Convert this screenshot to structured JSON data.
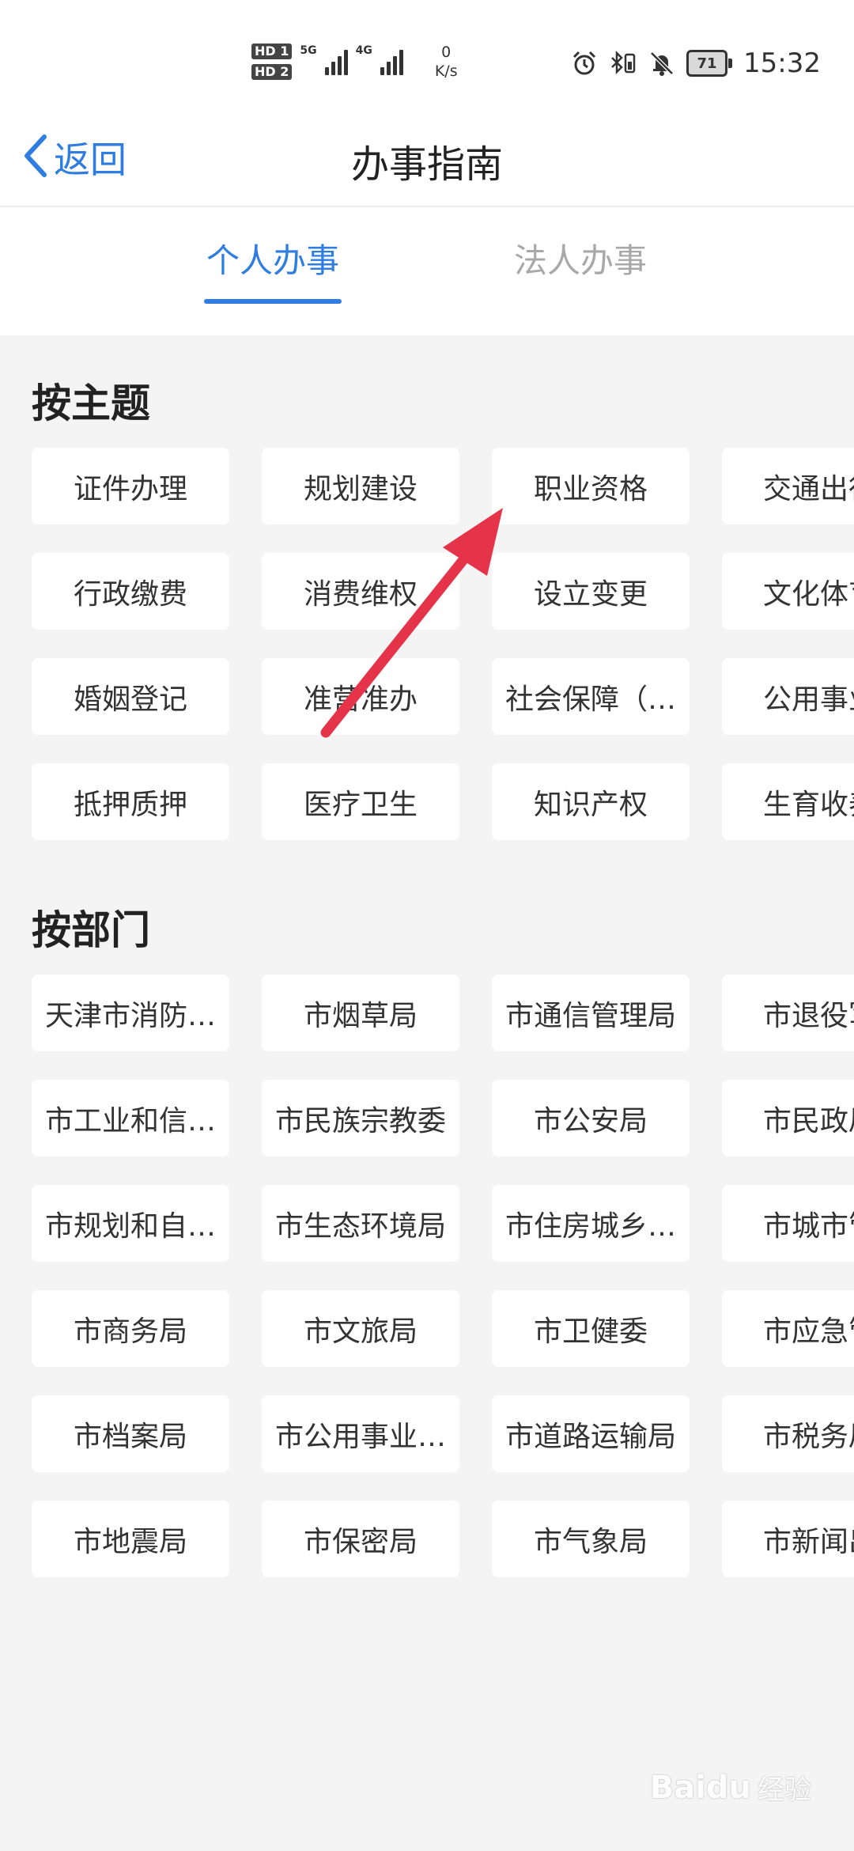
{
  "status_bar": {
    "sim1": "HD 1",
    "sim2": "HD 2",
    "net1": "5G",
    "net2": "4G",
    "speed_value": "0",
    "speed_unit": "K/s",
    "battery": "71",
    "time": "15:32"
  },
  "nav": {
    "back_label": "返回",
    "title": "办事指南"
  },
  "tabs": [
    {
      "label": "个人办事",
      "active": true
    },
    {
      "label": "法人办事",
      "active": false
    }
  ],
  "theme_section": {
    "title": "按主题",
    "items": [
      "证件办理",
      "规划建设",
      "职业资格",
      "交通出行",
      "行政缴费",
      "消费维权",
      "设立变更",
      "文化体育",
      "婚姻登记",
      "准营准办",
      "社会保障（…",
      "公用事业",
      "抵押质押",
      "医疗卫生",
      "知识产权",
      "生育收养"
    ]
  },
  "dept_section": {
    "title": "按部门",
    "items": [
      "天津市消防…",
      "市烟草局",
      "市通信管理局",
      "市退役军人",
      "市工业和信…",
      "市民族宗教委",
      "市公安局",
      "市民政局",
      "市规划和自…",
      "市生态环境局",
      "市住房城乡…",
      "市城市管理",
      "市商务局",
      "市文旅局",
      "市卫健委",
      "市应急管理",
      "市档案局",
      "市公用事业…",
      "市道路运输局",
      "市税务局",
      "市地震局",
      "市保密局",
      "市气象局",
      "市新闻出版"
    ]
  },
  "annotation": {
    "color": "#e5344a"
  },
  "watermark": {
    "brand": "Baidu",
    "suffix": "经验"
  },
  "colors": {
    "accent": "#2f7de1",
    "background": "#f4f4f5",
    "inactive_tab": "#a8a8a8"
  }
}
